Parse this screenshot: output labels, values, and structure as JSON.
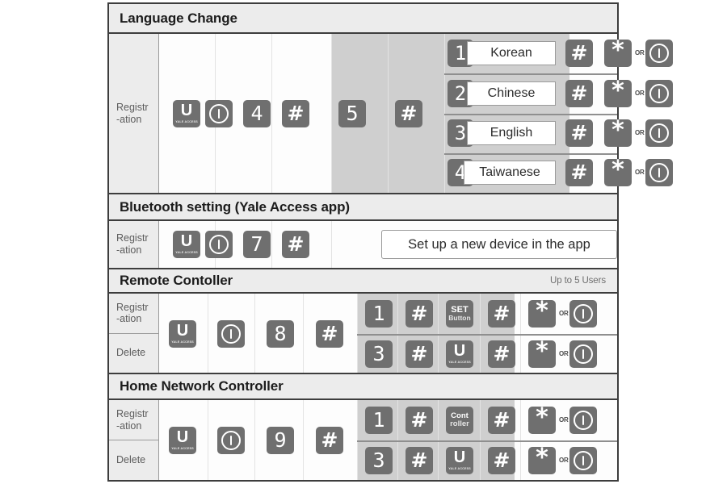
{
  "sections": [
    {
      "title": "Language Change",
      "note": "",
      "rows": [
        {
          "label_line1": "Registr",
          "label_line2": "-ation"
        }
      ],
      "prefix_keys": [
        {
          "type": "yale-u",
          "big": "U",
          "sub": "YALE ACCESS"
        },
        {
          "type": "power",
          "label": "I"
        },
        {
          "type": "digit",
          "label": "4"
        },
        {
          "type": "hash",
          "label": "#"
        },
        {
          "type": "digit",
          "label": "5"
        },
        {
          "type": "hash",
          "label": "#"
        }
      ],
      "language_options": [
        {
          "num": "1",
          "name": "Korean",
          "hash": "#",
          "star": "*",
          "or": "OR",
          "power": "I"
        },
        {
          "num": "2",
          "name": "Chinese",
          "hash": "#",
          "star": "*",
          "or": "OR",
          "power": "I"
        },
        {
          "num": "3",
          "name": "English",
          "hash": "#",
          "star": "*",
          "or": "OR",
          "power": "I"
        },
        {
          "num": "4",
          "name": "Taiwanese",
          "hash": "#",
          "star": "*",
          "or": "OR",
          "power": "I"
        }
      ]
    },
    {
      "title": "Bluetooth setting (Yale Access app)",
      "note": "",
      "rows": [
        {
          "label_line1": "Registr",
          "label_line2": "-ation"
        }
      ],
      "prefix_keys": [
        {
          "type": "yale-u",
          "big": "U",
          "sub": "YALE ACCESS"
        },
        {
          "type": "power",
          "label": "I"
        },
        {
          "type": "digit",
          "label": "7"
        },
        {
          "type": "hash",
          "label": "#"
        }
      ],
      "message": "Set up  a new device in the app"
    },
    {
      "title": "Remote Contoller",
      "note": "Up to 5 Users",
      "rows": [
        {
          "label_line1": "Registr",
          "label_line2": "-ation"
        },
        {
          "label_line1": "Delete",
          "label_line2": ""
        }
      ],
      "prefix_keys": [
        {
          "type": "yale-u",
          "big": "U",
          "sub": "YALE ACCESS"
        },
        {
          "type": "power",
          "label": "I"
        },
        {
          "type": "digit",
          "label": "8"
        },
        {
          "type": "hash",
          "label": "#"
        }
      ],
      "seq_registration": [
        {
          "type": "digit",
          "label": "1"
        },
        {
          "type": "hash",
          "label": "#"
        },
        {
          "type": "text2",
          "l1": "SET",
          "l2": "Button"
        },
        {
          "type": "hash",
          "label": "#"
        },
        {
          "type": "star",
          "label": "*"
        },
        {
          "type": "or",
          "label": "OR"
        },
        {
          "type": "power",
          "label": "I"
        }
      ],
      "seq_delete": [
        {
          "type": "digit",
          "label": "3"
        },
        {
          "type": "hash",
          "label": "#"
        },
        {
          "type": "yale-u",
          "big": "U",
          "sub": "YALE ACCESS"
        },
        {
          "type": "hash",
          "label": "#"
        },
        {
          "type": "star",
          "label": "*"
        },
        {
          "type": "or",
          "label": "OR"
        },
        {
          "type": "power",
          "label": "I"
        }
      ]
    },
    {
      "title": "Home Network Controller",
      "note": "",
      "rows": [
        {
          "label_line1": "Registr",
          "label_line2": "-ation"
        },
        {
          "label_line1": "Delete",
          "label_line2": ""
        }
      ],
      "prefix_keys": [
        {
          "type": "yale-u",
          "big": "U",
          "sub": "YALE ACCESS"
        },
        {
          "type": "power",
          "label": "I"
        },
        {
          "type": "digit",
          "label": "9"
        },
        {
          "type": "hash",
          "label": "#"
        }
      ],
      "seq_registration": [
        {
          "type": "digit",
          "label": "1"
        },
        {
          "type": "hash",
          "label": "#"
        },
        {
          "type": "text2",
          "l1": "Cont",
          "l2": "roller"
        },
        {
          "type": "hash",
          "label": "#"
        },
        {
          "type": "star",
          "label": "*"
        },
        {
          "type": "or",
          "label": "OR"
        },
        {
          "type": "power",
          "label": "I"
        }
      ],
      "seq_delete": [
        {
          "type": "digit",
          "label": "3"
        },
        {
          "type": "hash",
          "label": "#"
        },
        {
          "type": "yale-u",
          "big": "U",
          "sub": "YALE ACCESS"
        },
        {
          "type": "hash",
          "label": "#"
        },
        {
          "type": "star",
          "label": "*"
        },
        {
          "type": "or",
          "label": "OR"
        },
        {
          "type": "power",
          "label": "I"
        }
      ]
    }
  ],
  "colors": {
    "key_fill": "#6f6f6f",
    "frame": "#3d3d3d",
    "header_bg": "#ececec",
    "shade": "#cfcfcf",
    "page_bg": "#ffffff"
  }
}
